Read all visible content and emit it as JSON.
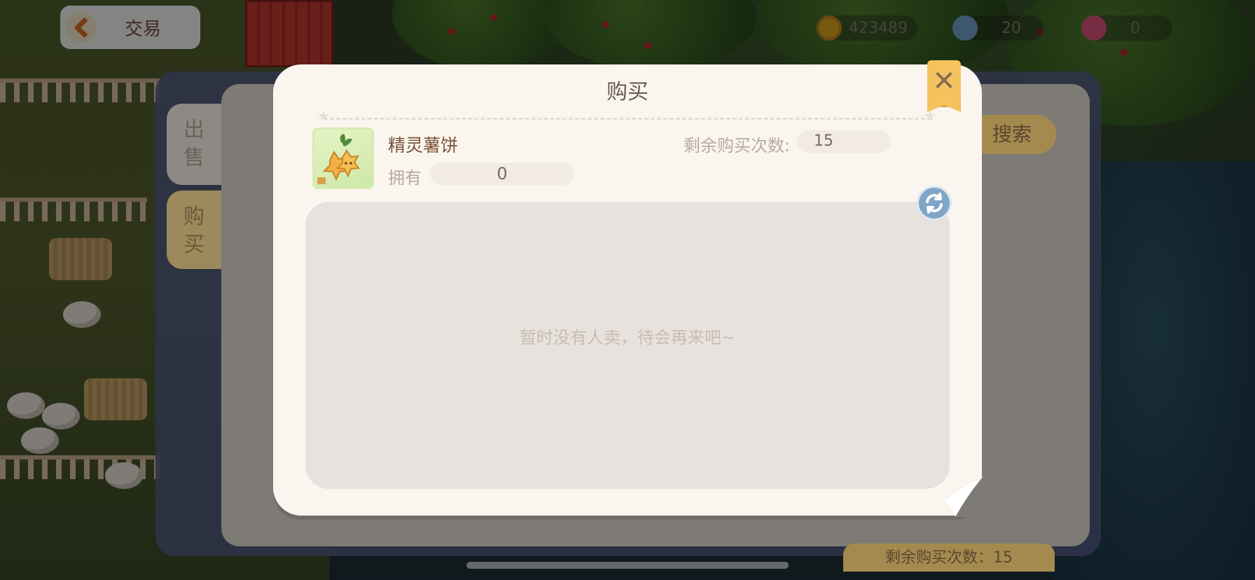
{
  "header": {
    "back_title": "交易",
    "back_icon": "back-arrow-icon"
  },
  "currency": [
    {
      "icon": "gold-coin-icon",
      "value": "423489",
      "color": "#d9a521"
    },
    {
      "icon": "blue-gem-icon",
      "value": "20",
      "color": "#6fa0c8"
    },
    {
      "icon": "pink-diamond-icon",
      "value": "0",
      "color": "#d8507a"
    }
  ],
  "trade_panel": {
    "tab_sell": "出售",
    "tab_buy": "购买",
    "search_button": "搜索",
    "remain_bottom": "剩余购买次数：15"
  },
  "modal": {
    "title": "购买",
    "close_icon": "close-icon",
    "item": {
      "name": "精灵薯饼",
      "owned_label": "拥有",
      "owned_value": "0",
      "icon": "potato-cake-icon"
    },
    "remaining_label": "剩余购买次数:",
    "remaining_value": "15",
    "refresh_icon": "refresh-icon",
    "empty_message": "暂时没有人卖，待会再来吧~"
  },
  "colors": {
    "modal_bg": "#faf6ef",
    "accent_yellow": "#f4c35e",
    "refresh_blue": "#7fa5c7"
  }
}
